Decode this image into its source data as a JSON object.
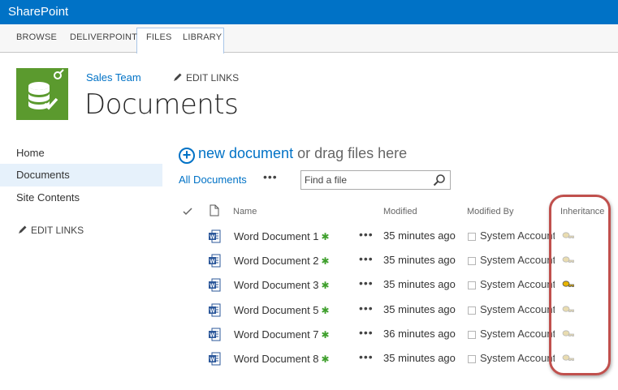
{
  "suitebar": {
    "brand": "SharePoint",
    "color": "#0072c6"
  },
  "ribbon": {
    "tabs": [
      "BROWSE",
      "DELIVERPOINT",
      "FILES",
      "LIBRARY"
    ]
  },
  "site": {
    "name": "Sales Team",
    "edit_links": "EDIT LINKS",
    "page_title": "Documents",
    "logo_icon": "database-check-icon"
  },
  "nav": {
    "items": [
      "Home",
      "Documents",
      "Site Contents"
    ],
    "selected": "Documents",
    "edit_links": "EDIT LINKS"
  },
  "toolbar": {
    "new_document": "new document",
    "drag_text": "or drag files here",
    "view_label": "All Documents",
    "more": "•••",
    "search_placeholder": "Find a file"
  },
  "table": {
    "headers": {
      "name": "Name",
      "modified": "Modified",
      "modified_by": "Modified By",
      "inheritance": "Inheritance"
    },
    "rows": [
      {
        "name": "Word Document 1",
        "new_marker": "✱",
        "modified": "35 minutes ago",
        "modified_by": "System Account",
        "inheritance_icon": "inherited-permissions-icon"
      },
      {
        "name": "Word Document 2",
        "new_marker": "✱",
        "modified": "35 minutes ago",
        "modified_by": "System Account",
        "inheritance_icon": "inherited-permissions-icon"
      },
      {
        "name": "Word Document 3",
        "new_marker": "✱",
        "modified": "35 minutes ago",
        "modified_by": "System Account",
        "inheritance_icon": "unique-permissions-icon"
      },
      {
        "name": "Word Document 5",
        "new_marker": "✱",
        "modified": "35 minutes ago",
        "modified_by": "System Account",
        "inheritance_icon": "inherited-permissions-icon"
      },
      {
        "name": "Word Document 7",
        "new_marker": "✱",
        "modified": "36 minutes ago",
        "modified_by": "System Account",
        "inheritance_icon": "inherited-permissions-icon"
      },
      {
        "name": "Word Document 8",
        "new_marker": "✱",
        "modified": "35 minutes ago",
        "modified_by": "System Account",
        "inheritance_icon": "inherited-permissions-icon"
      }
    ]
  },
  "colors": {
    "accent": "#0072c6",
    "logo": "#5b9a2e",
    "new_marker": "#3e9f2c",
    "highlight": "#c0504d",
    "selected_nav": "#e6f1fb"
  }
}
